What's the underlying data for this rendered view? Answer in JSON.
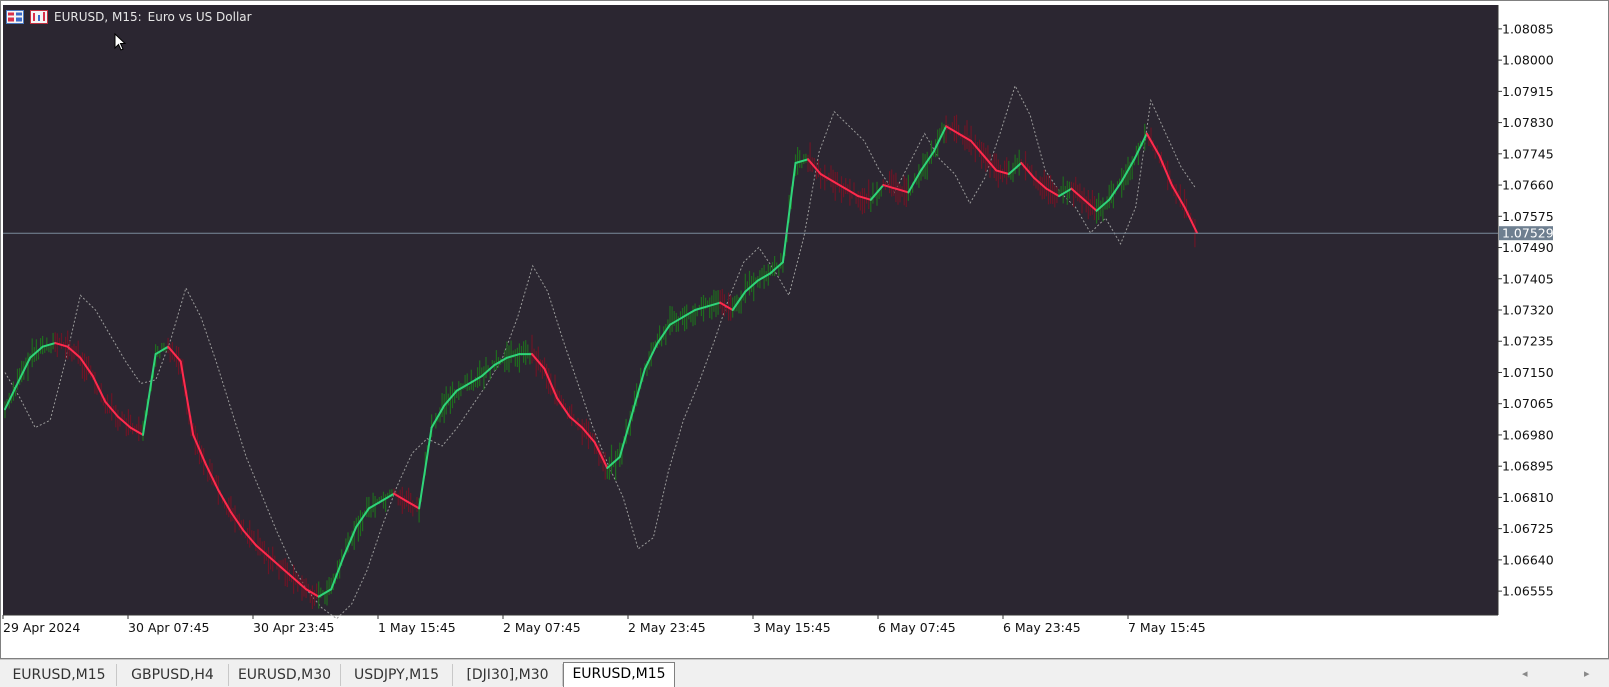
{
  "window": {
    "symbol_label": "EURUSD, M15:",
    "description": "Euro vs US Dollar"
  },
  "price_axis": {
    "ticks": [
      "1.08085",
      "1.08000",
      "1.07915",
      "1.07830",
      "1.07745",
      "1.07660",
      "1.07575",
      "1.07490",
      "1.07405",
      "1.07320",
      "1.07235",
      "1.07150",
      "1.07065",
      "1.06980",
      "1.06895",
      "1.06810",
      "1.06725",
      "1.06640",
      "1.06555"
    ],
    "current_price": "1.07529"
  },
  "time_axis": {
    "ticks": [
      "29 Apr 2024",
      "30 Apr 07:45",
      "30 Apr 23:45",
      "1 May 15:45",
      "2 May 07:45",
      "2 May 23:45",
      "3 May 15:45",
      "6 May 07:45",
      "6 May 23:45",
      "7 May 15:45"
    ]
  },
  "tabs": [
    {
      "label": "EURUSD,M15",
      "active": false
    },
    {
      "label": "GBPUSD,H4",
      "active": false
    },
    {
      "label": "EURUSD,M30",
      "active": false
    },
    {
      "label": "USDJPY,M15",
      "active": false
    },
    {
      "label": "[DJI30],M30",
      "active": false
    },
    {
      "label": "EURUSD,M15",
      "active": true
    }
  ],
  "colors": {
    "background": "#2b2631",
    "up": "#2fd47a",
    "up_dark": "#1f6b1f",
    "down": "#ff2a4d",
    "down_dark": "#6b1526",
    "band": "#9a9a9a",
    "price_line": "#7a8a9a",
    "price_label_bg": "#6e7f90"
  },
  "chart_data": {
    "type": "line",
    "y_range": [
      1.0649,
      1.0815
    ],
    "x_labels": [
      "29 Apr 2024",
      "30 Apr 07:45",
      "30 Apr 23:45",
      "1 May 15:45",
      "2 May 07:45",
      "2 May 23:45",
      "3 May 15:45",
      "6 May 07:45",
      "6 May 23:45",
      "7 May 15:45"
    ],
    "current_price": 1.07529,
    "series": [
      {
        "values": [
          1.0705,
          1.0712,
          1.0719,
          1.0722,
          1.0723,
          1.0722,
          1.0719,
          1.0714,
          1.0707,
          1.0703,
          1.07,
          1.0698,
          1.072,
          1.0722,
          1.0718,
          1.0698,
          1.069,
          1.0683,
          1.0677,
          1.0672,
          1.0668,
          1.0665,
          1.0662,
          1.0659,
          1.0656,
          1.0654,
          1.0656,
          1.0665,
          1.0673,
          1.0678,
          1.068,
          1.0682,
          1.068,
          1.0678,
          1.07,
          1.0706,
          1.071,
          1.0712,
          1.0714,
          1.0717,
          1.0719,
          1.072,
          1.072,
          1.0716,
          1.0708,
          1.0703,
          1.07,
          1.0696,
          1.0689,
          1.0692,
          1.0704,
          1.0716,
          1.0723,
          1.0728,
          1.073,
          1.0732,
          1.0733,
          1.0734,
          1.0732,
          1.0737,
          1.074,
          1.0742,
          1.0745,
          1.0772,
          1.0773,
          1.0769,
          1.0767,
          1.0765,
          1.0763,
          1.0762,
          1.0766,
          1.0765,
          1.0764,
          1.077,
          1.0775,
          1.0782,
          1.078,
          1.0778,
          1.0774,
          1.077,
          1.0769,
          1.0772,
          1.0768,
          1.0765,
          1.0763,
          1.0765,
          1.0762,
          1.0759,
          1.0762,
          1.0767,
          1.0773,
          1.078,
          1.0774,
          1.0766,
          1.076,
          1.0753
        ]
      },
      {
        "values": [
          1.0715,
          1.0708,
          1.07,
          1.0702,
          1.0718,
          1.0736,
          1.0732,
          1.0725,
          1.0718,
          1.0712,
          1.0713,
          1.0724,
          1.0738,
          1.073,
          1.0718,
          1.0705,
          1.0692,
          1.0682,
          1.0672,
          1.0663,
          1.0656,
          1.0651,
          1.0648,
          1.0652,
          1.0661,
          1.0673,
          1.0684,
          1.0693,
          1.0697,
          1.0695,
          1.07,
          1.0706,
          1.0712,
          1.0719,
          1.073,
          1.0744,
          1.0737,
          1.0724,
          1.0712,
          1.07,
          1.069,
          1.0681,
          1.0667,
          1.067,
          1.0688,
          1.0702,
          1.0712,
          1.0723,
          1.0735,
          1.0745,
          1.0749,
          1.0743,
          1.0736,
          1.0752,
          1.0775,
          1.0786,
          1.0782,
          1.0778,
          1.077,
          1.0764,
          1.0772,
          1.078,
          1.0773,
          1.0769,
          1.0761,
          1.0768,
          1.078,
          1.0793,
          1.0785,
          1.077,
          1.0764,
          1.076,
          1.0753,
          1.0757,
          1.075,
          1.076,
          1.0789,
          1.078,
          1.0771,
          1.0765
        ]
      }
    ]
  }
}
